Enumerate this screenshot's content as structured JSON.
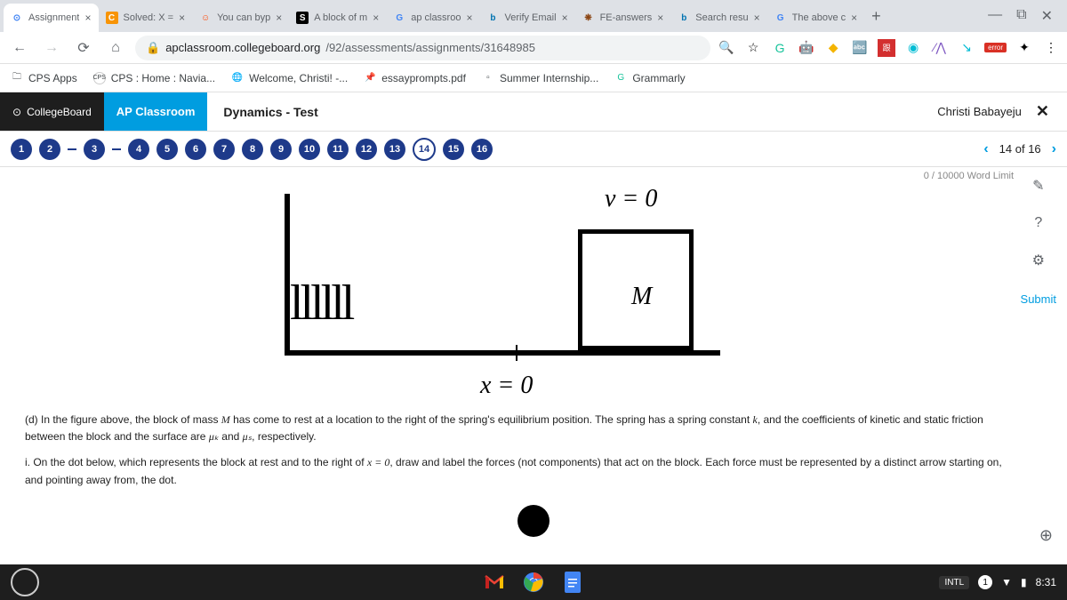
{
  "browser": {
    "tabs": [
      {
        "favicon": "⊙",
        "fcolor": "#4285f4",
        "title": "Assignment"
      },
      {
        "favicon": "C",
        "fcolor": "#fff",
        "fbg": "#f89406",
        "title": "Solved: X ="
      },
      {
        "favicon": "☺",
        "fcolor": "#ff4500",
        "title": "You can byp"
      },
      {
        "favicon": "S",
        "fcolor": "#fff",
        "fbg": "#000",
        "title": "A block of m"
      },
      {
        "favicon": "G",
        "fcolor": "#4285f4",
        "title": "ap classroo"
      },
      {
        "favicon": "b",
        "fcolor": "#0073b1",
        "title": "Verify Email"
      },
      {
        "favicon": "❋",
        "fcolor": "#8b4513",
        "title": "FE-answers"
      },
      {
        "favicon": "b",
        "fcolor": "#0073b1",
        "title": "Search resu"
      },
      {
        "favicon": "G",
        "fcolor": "#4285f4",
        "title": "The above c"
      }
    ],
    "url_domain": "apclassroom.collegeboard.org",
    "url_path": "/92/assessments/assignments/31648985",
    "error_label": "error"
  },
  "bookmarks": [
    {
      "icon": "🗀",
      "label": "CPS Apps"
    },
    {
      "icon": "⊙",
      "label": "CPS : Home : Navia..."
    },
    {
      "icon": "🌐",
      "label": "Welcome, Christi! -..."
    },
    {
      "icon": "📌",
      "label": "essayprompts.pdf"
    },
    {
      "icon": "▫",
      "label": "Summer Internship..."
    },
    {
      "icon": "G",
      "label": "Grammarly"
    }
  ],
  "app": {
    "collegeboard": "CollegeBoard",
    "apclassroom": "AP Classroom",
    "test_title": "Dynamics - Test",
    "user_name": "Christi Babayeju",
    "close": "✕"
  },
  "navigation": {
    "questions": [
      1,
      2,
      3,
      4,
      5,
      6,
      7,
      8,
      9,
      10,
      11,
      12,
      13,
      14,
      15,
      16
    ],
    "current": 14,
    "counter": "14 of 16"
  },
  "content": {
    "word_limit": "0 / 10000 Word Limit",
    "v_label": "v = 0",
    "m_label": "M",
    "x_label": "x = 0",
    "spring": "llllll",
    "para_d_prefix": "(d) In the figure above, the block of mass ",
    "para_d_M": "M",
    "para_d_mid1": " has come to rest at a location to the right of the spring's equilibrium position. The spring has a spring constant ",
    "para_d_k": "k",
    "para_d_mid2": ", and the coefficients of kinetic and static friction between the block and the surface are ",
    "para_d_muk": "μₖ",
    "para_d_and": " and ",
    "para_d_mus": "μₛ",
    "para_d_end": ", respectively.",
    "para_i_prefix": "i. On the dot below, which represents the block at rest and to the right of ",
    "para_i_x": "x = 0",
    "para_i_end": ", draw and label the forces (not components) that act on the block. Each force must be represented by a distinct arrow starting on, and pointing away from, the dot.",
    "submit_label": "Submit"
  },
  "taskbar": {
    "intl": "INTL",
    "time": "8:31"
  }
}
